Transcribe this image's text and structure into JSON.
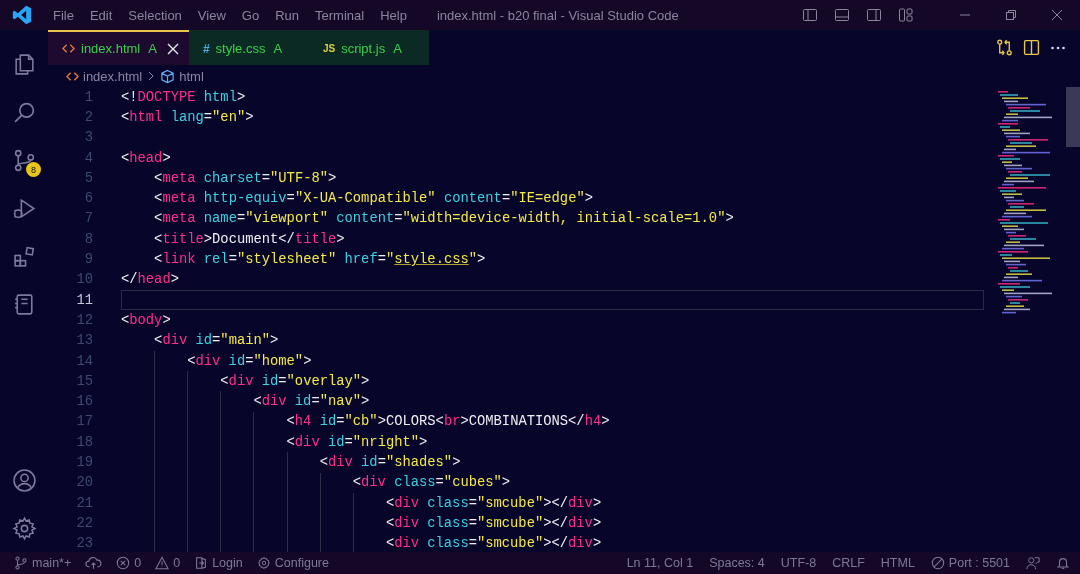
{
  "window": {
    "title": "index.html - b20 final - Visual Studio Code"
  },
  "menu": [
    "File",
    "Edit",
    "Selection",
    "View",
    "Go",
    "Run",
    "Terminal",
    "Help"
  ],
  "activity_bar": {
    "items": [
      {
        "kind": "explorer"
      },
      {
        "kind": "search"
      },
      {
        "kind": "source-control",
        "badge": "8"
      },
      {
        "kind": "run"
      },
      {
        "kind": "extensions"
      },
      {
        "kind": "notebook"
      }
    ],
    "bottom": [
      {
        "kind": "account"
      },
      {
        "kind": "settings"
      }
    ]
  },
  "tabs": [
    {
      "kind": "html",
      "label": "index.html",
      "status": "A",
      "selected": true
    },
    {
      "kind": "css",
      "icon": "#",
      "label": "style.css",
      "status": "A",
      "selected": false
    },
    {
      "kind": "js",
      "icon": "JS",
      "label": "script.js",
      "status": "A",
      "selected": false
    }
  ],
  "breadcrumbs": [
    "index.html",
    "html"
  ],
  "lines": [
    {
      "num": "1",
      "current": false,
      "tokens": [
        {
          "kind": "p",
          "text": "<!"
        },
        {
          "kind": "t",
          "text": "DOCTYPE"
        },
        {
          "kind": "a",
          "text": " html"
        },
        {
          "kind": "p",
          "text": ">"
        }
      ]
    },
    {
      "num": "2",
      "current": false,
      "tokens": [
        {
          "kind": "p",
          "text": "<"
        },
        {
          "kind": "t",
          "text": "html"
        },
        {
          "kind": "a",
          "text": " lang"
        },
        {
          "kind": "p",
          "text": "="
        },
        {
          "kind": "s",
          "text": "\"en\""
        },
        {
          "kind": "p",
          "text": ">"
        }
      ]
    },
    {
      "num": "3",
      "current": false
    },
    {
      "num": "4",
      "current": false,
      "tokens": [
        {
          "kind": "p",
          "text": "<"
        },
        {
          "kind": "t",
          "text": "head"
        },
        {
          "kind": "p",
          "text": ">"
        }
      ]
    },
    {
      "num": "5",
      "current": false,
      "tokens": [
        {
          "kind": "p",
          "text": "    <"
        },
        {
          "kind": "t",
          "text": "meta"
        },
        {
          "kind": "a",
          "text": " charset"
        },
        {
          "kind": "p",
          "text": "="
        },
        {
          "kind": "s",
          "text": "\"UTF-8\""
        },
        {
          "kind": "p",
          "text": ">"
        }
      ]
    },
    {
      "num": "6",
      "current": false,
      "tokens": [
        {
          "kind": "p",
          "text": "    <"
        },
        {
          "kind": "t",
          "text": "meta"
        },
        {
          "kind": "a",
          "text": " http-equiv"
        },
        {
          "kind": "p",
          "text": "="
        },
        {
          "kind": "s",
          "text": "\"X-UA-Compatible\""
        },
        {
          "kind": "a",
          "text": " content"
        },
        {
          "kind": "p",
          "text": "="
        },
        {
          "kind": "s",
          "text": "\"IE=edge\""
        },
        {
          "kind": "p",
          "text": ">"
        }
      ]
    },
    {
      "num": "7",
      "current": false,
      "tokens": [
        {
          "kind": "p",
          "text": "    <"
        },
        {
          "kind": "t",
          "text": "meta"
        },
        {
          "kind": "a",
          "text": " name"
        },
        {
          "kind": "p",
          "text": "="
        },
        {
          "kind": "s",
          "text": "\"viewport\""
        },
        {
          "kind": "a",
          "text": " content"
        },
        {
          "kind": "p",
          "text": "="
        },
        {
          "kind": "s",
          "text": "\"width=device-width, initial-scale=1.0\""
        },
        {
          "kind": "p",
          "text": ">"
        }
      ]
    },
    {
      "num": "8",
      "current": false,
      "tokens": [
        {
          "kind": "p",
          "text": "    <"
        },
        {
          "kind": "t",
          "text": "title"
        },
        {
          "kind": "p",
          "text": ">"
        },
        {
          "kind": "x",
          "text": "Document"
        },
        {
          "kind": "p",
          "text": "</"
        },
        {
          "kind": "t",
          "text": "title"
        },
        {
          "kind": "p",
          "text": ">"
        }
      ]
    },
    {
      "num": "9",
      "current": false,
      "tokens": [
        {
          "kind": "p",
          "text": "    <"
        },
        {
          "kind": "t",
          "text": "link"
        },
        {
          "kind": "a",
          "text": " rel"
        },
        {
          "kind": "p",
          "text": "="
        },
        {
          "kind": "s",
          "text": "\"stylesheet\""
        },
        {
          "kind": "a",
          "text": " href"
        },
        {
          "kind": "p",
          "text": "="
        },
        {
          "kind": "s",
          "text": "\""
        },
        {
          "kind": "link",
          "text": "style.css"
        },
        {
          "kind": "s",
          "text": "\""
        },
        {
          "kind": "p",
          "text": ">"
        }
      ]
    },
    {
      "num": "10",
      "current": false,
      "tokens": [
        {
          "kind": "p",
          "text": "</"
        },
        {
          "kind": "t",
          "text": "head"
        },
        {
          "kind": "p",
          "text": ">"
        }
      ]
    },
    {
      "num": "11",
      "current": true
    },
    {
      "num": "12",
      "current": false,
      "tokens": [
        {
          "kind": "p",
          "text": "<"
        },
        {
          "kind": "t",
          "text": "body"
        },
        {
          "kind": "p",
          "text": ">"
        }
      ]
    },
    {
      "num": "13",
      "current": false,
      "tokens": [
        {
          "kind": "p",
          "text": "    <"
        },
        {
          "kind": "t",
          "text": "div"
        },
        {
          "kind": "a",
          "text": " id"
        },
        {
          "kind": "p",
          "text": "="
        },
        {
          "kind": "s",
          "text": "\"main\""
        },
        {
          "kind": "p",
          "text": ">"
        }
      ]
    },
    {
      "num": "14",
      "current": false,
      "tokens": [
        {
          "kind": "p",
          "text": "        <"
        },
        {
          "kind": "t",
          "text": "div"
        },
        {
          "kind": "a",
          "text": " id"
        },
        {
          "kind": "p",
          "text": "="
        },
        {
          "kind": "s",
          "text": "\"home\""
        },
        {
          "kind": "p",
          "text": ">"
        }
      ]
    },
    {
      "num": "15",
      "current": false,
      "tokens": [
        {
          "kind": "p",
          "text": "            <"
        },
        {
          "kind": "t",
          "text": "div"
        },
        {
          "kind": "a",
          "text": " id"
        },
        {
          "kind": "p",
          "text": "="
        },
        {
          "kind": "s",
          "text": "\"overlay\""
        },
        {
          "kind": "p",
          "text": ">"
        }
      ]
    },
    {
      "num": "16",
      "current": false,
      "tokens": [
        {
          "kind": "p",
          "text": "                <"
        },
        {
          "kind": "t",
          "text": "div"
        },
        {
          "kind": "a",
          "text": " id"
        },
        {
          "kind": "p",
          "text": "="
        },
        {
          "kind": "s",
          "text": "\"nav\""
        },
        {
          "kind": "p",
          "text": ">"
        }
      ]
    },
    {
      "num": "17",
      "current": false,
      "tokens": [
        {
          "kind": "p",
          "text": "                    <"
        },
        {
          "kind": "t",
          "text": "h4"
        },
        {
          "kind": "a",
          "text": " id"
        },
        {
          "kind": "p",
          "text": "="
        },
        {
          "kind": "s",
          "text": "\"cb\""
        },
        {
          "kind": "p",
          "text": ">"
        },
        {
          "kind": "x",
          "text": "COLORS"
        },
        {
          "kind": "p",
          "text": "<"
        },
        {
          "kind": "t",
          "text": "br"
        },
        {
          "kind": "p",
          "text": ">"
        },
        {
          "kind": "x",
          "text": "COMBINATIONS"
        },
        {
          "kind": "p",
          "text": "</"
        },
        {
          "kind": "t",
          "text": "h4"
        },
        {
          "kind": "p",
          "text": ">"
        }
      ]
    },
    {
      "num": "18",
      "current": false,
      "tokens": [
        {
          "kind": "p",
          "text": "                    <"
        },
        {
          "kind": "t",
          "text": "div"
        },
        {
          "kind": "a",
          "text": " id"
        },
        {
          "kind": "p",
          "text": "="
        },
        {
          "kind": "s",
          "text": "\"nright\""
        },
        {
          "kind": "p",
          "text": ">"
        }
      ]
    },
    {
      "num": "19",
      "current": false,
      "tokens": [
        {
          "kind": "p",
          "text": "                        <"
        },
        {
          "kind": "t",
          "text": "div"
        },
        {
          "kind": "a",
          "text": " id"
        },
        {
          "kind": "p",
          "text": "="
        },
        {
          "kind": "s",
          "text": "\"shades\""
        },
        {
          "kind": "p",
          "text": ">"
        }
      ]
    },
    {
      "num": "20",
      "current": false,
      "tokens": [
        {
          "kind": "p",
          "text": "                            <"
        },
        {
          "kind": "t",
          "text": "div"
        },
        {
          "kind": "a",
          "text": " class"
        },
        {
          "kind": "p",
          "text": "="
        },
        {
          "kind": "s",
          "text": "\"cubes\""
        },
        {
          "kind": "p",
          "text": ">"
        }
      ]
    },
    {
      "num": "21",
      "current": false,
      "tokens": [
        {
          "kind": "p",
          "text": "                                <"
        },
        {
          "kind": "t",
          "text": "div"
        },
        {
          "kind": "a",
          "text": " class"
        },
        {
          "kind": "p",
          "text": "="
        },
        {
          "kind": "s",
          "text": "\"smcube\""
        },
        {
          "kind": "p",
          "text": "></"
        },
        {
          "kind": "t",
          "text": "div"
        },
        {
          "kind": "p",
          "text": ">"
        }
      ]
    },
    {
      "num": "22",
      "current": false,
      "tokens": [
        {
          "kind": "p",
          "text": "                                <"
        },
        {
          "kind": "t",
          "text": "div"
        },
        {
          "kind": "a",
          "text": " class"
        },
        {
          "kind": "p",
          "text": "="
        },
        {
          "kind": "s",
          "text": "\"smcube\""
        },
        {
          "kind": "p",
          "text": "></"
        },
        {
          "kind": "t",
          "text": "div"
        },
        {
          "kind": "p",
          "text": ">"
        }
      ]
    },
    {
      "num": "23",
      "current": false,
      "tokens": [
        {
          "kind": "p",
          "text": "                                <"
        },
        {
          "kind": "t",
          "text": "div"
        },
        {
          "kind": "a",
          "text": " class"
        },
        {
          "kind": "p",
          "text": "="
        },
        {
          "kind": "s",
          "text": "\"smcube\""
        },
        {
          "kind": "p",
          "text": "></"
        },
        {
          "kind": "t",
          "text": "div"
        },
        {
          "kind": "p",
          "text": ">"
        }
      ]
    }
  ],
  "status_bar": {
    "left": [
      {
        "kind": "branch",
        "text": "main*+"
      },
      {
        "kind": "sync"
      },
      {
        "kind": "errors",
        "text": "0"
      },
      {
        "kind": "warnings",
        "text": "0"
      },
      {
        "kind": "login",
        "text": "Login"
      },
      {
        "kind": "configure",
        "text": "Configure"
      }
    ],
    "right": [
      {
        "kind": "text",
        "text": "Ln 11, Col 1"
      },
      {
        "kind": "text",
        "text": "Spaces: 4"
      },
      {
        "kind": "text",
        "text": "UTF-8"
      },
      {
        "kind": "text",
        "text": "CRLF"
      },
      {
        "kind": "text",
        "text": "HTML"
      },
      {
        "kind": "port",
        "text": "Port : 5501"
      },
      {
        "kind": "feedback"
      },
      {
        "kind": "bell"
      }
    ]
  }
}
